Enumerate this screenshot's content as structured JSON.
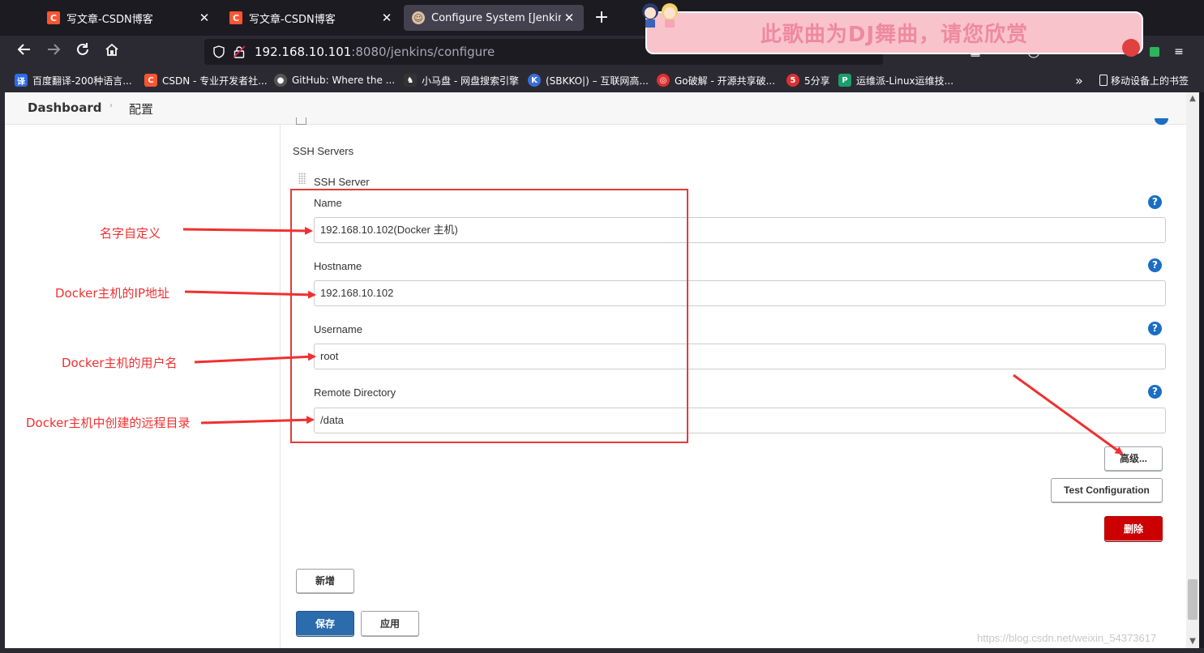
{
  "browser": {
    "tabs": [
      {
        "title": "写文章-CSDN博客",
        "icon": "csdn-icon",
        "active": false
      },
      {
        "title": "写文章-CSDN博客",
        "icon": "csdn-icon",
        "active": false
      },
      {
        "title": "Configure System [Jenkins]",
        "icon": "jenkins-icon",
        "active": true
      }
    ],
    "tab_close_glyph": "✕",
    "new_tab_glyph": "+",
    "url_host": "192.168.10.101",
    "url_path": ":8080/jenkins/configure",
    "banner_text": "此歌曲为DJ舞曲，请您欣赏",
    "bookmarks": [
      {
        "label": "百度翻译-200种语言...",
        "icon": "translate-icon",
        "color": "#2e6be6",
        "glyph": "译"
      },
      {
        "label": "CSDN - 专业开发者社...",
        "icon": "csdn-icon",
        "color": "#fc5531",
        "glyph": "C"
      },
      {
        "label": "GitHub: Where the ...",
        "icon": "github-icon",
        "color": "#555555",
        "glyph": "●"
      },
      {
        "label": "小马盘 - 网盘搜索引擎",
        "icon": "horse-icon",
        "color": "#333333",
        "glyph": "♞"
      },
      {
        "label": "(SBKKO|) – 互联网高...",
        "icon": "k-icon",
        "color": "#3b6fd6",
        "glyph": "K"
      },
      {
        "label": "Go破解 - 开源共享破...",
        "icon": "go-icon",
        "color": "#e03030",
        "glyph": "◎"
      },
      {
        "label": "5分享",
        "icon": "five-icon",
        "color": "#e03030",
        "glyph": "5"
      },
      {
        "label": "运维派-Linux运维技...",
        "icon": "ops-icon",
        "color": "#1a9e6a",
        "glyph": "P"
      }
    ],
    "bookmarks_overflow": "»",
    "mobile_bookmarks": "移动设备上的书签"
  },
  "breadcrumb": {
    "dashboard": "Dashboard",
    "separator": "›",
    "current": "配置"
  },
  "form": {
    "section_title": "SSH Servers",
    "server_title": "SSH Server",
    "name_label": "Name",
    "name_value": "192.168.10.102(Docker 主机)",
    "hostname_label": "Hostname",
    "hostname_value": "192.168.10.102",
    "username_label": "Username",
    "username_value": "root",
    "remote_dir_label": "Remote Directory",
    "remote_dir_value": "/data",
    "help_glyph": "?",
    "advanced_button": "高级...",
    "test_button": "Test Configuration",
    "delete_button": "删除",
    "add_button": "新增",
    "save_button": "保存",
    "apply_button": "应用"
  },
  "annotations": {
    "name_note": "名字自定义",
    "hostname_note": "Docker主机的IP地址",
    "username_note": "Docker主机的用户名",
    "remote_dir_note": "Docker主机中创建的远程目录",
    "color": "#f03030"
  },
  "watermark": "https://blog.csdn.net/weixin_54373617"
}
